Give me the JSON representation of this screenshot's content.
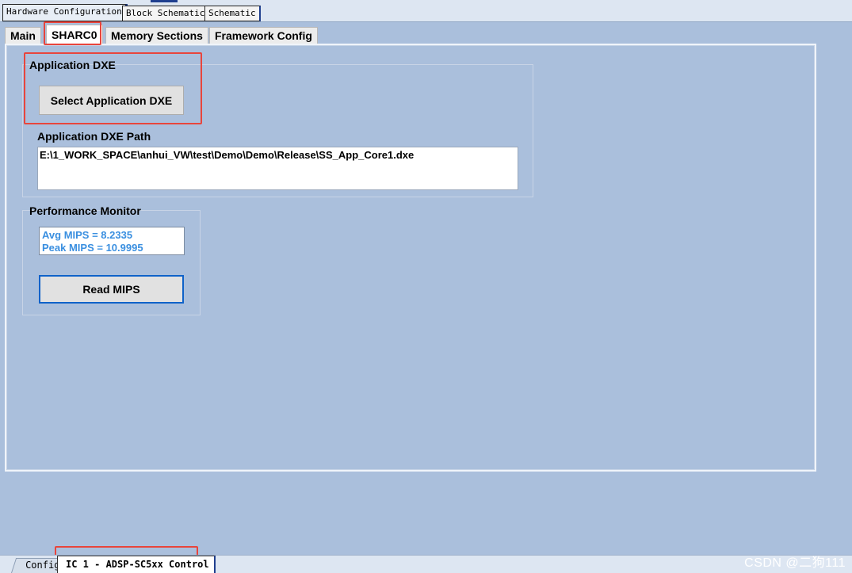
{
  "doc_tabs": [
    "Hardware Configuration",
    "Block Schematic",
    "Schematic"
  ],
  "inner_tabs": [
    "Main",
    "SHARC0",
    "Memory Sections",
    "Framework Config"
  ],
  "application_dxe": {
    "group_title": "Application DXE",
    "select_button": "Select Application DXE",
    "path_label": "Application DXE Path",
    "path_value": "E:\\1_WORK_SPACE\\anhui_VW\\test\\Demo\\Demo\\Release\\SS_App_Core1.dxe"
  },
  "performance_monitor": {
    "group_title": "Performance Monitor",
    "avg_mips": "Avg MIPS = 8.2335",
    "peak_mips": "Peak MIPS = 10.9995",
    "read_button": "Read MIPS"
  },
  "bottom_tabs": {
    "config": "Config",
    "control": "IC 1 - ADSP-SC5xx Control"
  },
  "watermark": "CSDN @二狗111",
  "colors": {
    "background": "#aabfdc",
    "highlight": "#e8453c",
    "mips_text": "#3a8fe0",
    "focus": "#0f62c9"
  }
}
